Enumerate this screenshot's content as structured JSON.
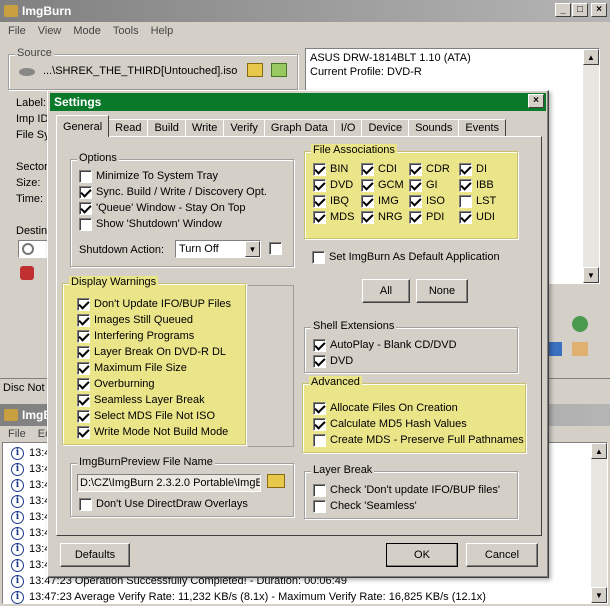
{
  "main": {
    "title": "ImgBurn",
    "menu": [
      "File",
      "View",
      "Mode",
      "Tools",
      "Help"
    ],
    "source_label": "Source",
    "source_path": "...\\SHREK_THE_THIRD[Untouched].iso",
    "drive_name": "ASUS DRW-1814BLT 1.10 (ATA)",
    "drive_profile": "Current Profile: DVD-R",
    "left_labels": [
      "Label:",
      "Imp ID",
      "File Sy",
      "Sector",
      "Size:",
      "Time:"
    ],
    "dest_label": "Destin",
    "status_text": "Disc Not E"
  },
  "log": {
    "title": "ImgB",
    "menu": [
      "File",
      "Ed"
    ],
    "times": [
      "13:4",
      "13:4",
      "13:4",
      "13:4",
      "13:4",
      "13:4",
      "13:4",
      "13:4",
      "13:4",
      "13:4"
    ],
    "full_lines": [
      "13:47:23 Operation Successfully Completed! - Duration: 00:06:49",
      "13:47:23 Average Verify Rate: 11,232 KB/s (8.1x) - Maximum Verify Rate: 16,825 KB/s (12.1x)"
    ]
  },
  "settings": {
    "title": "Settings",
    "tabs": [
      "General",
      "Read",
      "Build",
      "Write",
      "Verify",
      "Graph Data",
      "I/O",
      "Device",
      "Sounds",
      "Events"
    ],
    "options": {
      "title": "Options",
      "items": [
        {
          "label": "Minimize To System Tray",
          "checked": false
        },
        {
          "label": "Sync. Build / Write / Discovery Opt.",
          "checked": true
        },
        {
          "label": "'Queue' Window - Stay On Top",
          "checked": true
        },
        {
          "label": "Show 'Shutdown' Window",
          "checked": false
        }
      ],
      "shutdown_label": "Shutdown Action:",
      "shutdown_value": "Turn Off"
    },
    "file_assoc": {
      "title": "File Associations",
      "items": [
        {
          "label": "BIN",
          "checked": true
        },
        {
          "label": "CDI",
          "checked": true
        },
        {
          "label": "CDR",
          "checked": true
        },
        {
          "label": "DI",
          "checked": true
        },
        {
          "label": "DVD",
          "checked": true
        },
        {
          "label": "GCM",
          "checked": true
        },
        {
          "label": "GI",
          "checked": true
        },
        {
          "label": "IBB",
          "checked": true
        },
        {
          "label": "IBQ",
          "checked": true
        },
        {
          "label": "IMG",
          "checked": true
        },
        {
          "label": "ISO",
          "checked": true
        },
        {
          "label": "LST",
          "checked": false
        },
        {
          "label": "MDS",
          "checked": true
        },
        {
          "label": "NRG",
          "checked": true
        },
        {
          "label": "PDI",
          "checked": true
        },
        {
          "label": "UDI",
          "checked": true
        }
      ],
      "set_default_label": "Set ImgBurn As Default Application",
      "all_button": "All",
      "none_button": "None"
    },
    "display_warnings": {
      "title": "Display Warnings",
      "items": [
        {
          "label": "Don't Update IFO/BUP Files",
          "checked": true
        },
        {
          "label": "Images Still Queued",
          "checked": true
        },
        {
          "label": "Interfering Programs",
          "checked": true
        },
        {
          "label": "Layer Break On DVD-R DL",
          "checked": true
        },
        {
          "label": "Maximum File Size",
          "checked": true
        },
        {
          "label": "Overburning",
          "checked": true
        },
        {
          "label": "Seamless Layer Break",
          "checked": true
        },
        {
          "label": "Select MDS File Not ISO",
          "checked": true
        },
        {
          "label": "Write Mode Not Build Mode",
          "checked": true
        }
      ]
    },
    "shell_ext": {
      "title": "Shell Extensions",
      "items": [
        {
          "label": "AutoPlay - Blank CD/DVD",
          "checked": true
        },
        {
          "label": "DVD",
          "checked": true
        }
      ]
    },
    "advanced": {
      "title": "Advanced",
      "items": [
        {
          "label": "Allocate Files On Creation",
          "checked": true
        },
        {
          "label": "Calculate MD5 Hash Values",
          "checked": true
        },
        {
          "label": "Create MDS - Preserve Full Pathnames",
          "checked": false
        }
      ]
    },
    "preview": {
      "title": "ImgBurnPreview File Name",
      "path": "D:\\CZ\\ImgBurn 2.3.2.0 Portable\\ImgE",
      "directdraw_label": "Don't Use DirectDraw Overlays"
    },
    "layer_break": {
      "title": "Layer Break",
      "items": [
        {
          "label": "Check 'Don't update IFO/BUP files'",
          "checked": false
        },
        {
          "label": "Check 'Seamless'",
          "checked": false
        }
      ]
    },
    "defaults_button": "Defaults",
    "ok_button": "OK",
    "cancel_button": "Cancel"
  }
}
